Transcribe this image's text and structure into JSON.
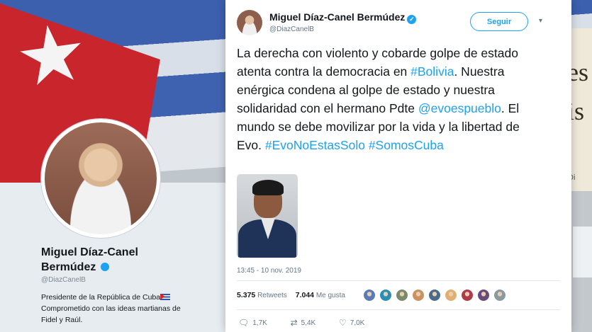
{
  "background_profile": {
    "name_line1": "Miguel Díaz-Canel",
    "name_line2": "Bermúdez",
    "handle": "@DiazCanelB",
    "bio_line1": "Presidente de la República de Cuba",
    "bio_line2": "Comprometido con las ideas martianas de",
    "bio_line3": "Fidel y Raúl.",
    "right_text_1": "es",
    "right_text_2": "is",
    "right_small": "Di"
  },
  "tweet": {
    "author_name": "Miguel Díaz-Canel Bermúdez",
    "author_handle": "@DiazCanelB",
    "follow_label": "Seguir",
    "text_segments": {
      "s1": "La derecha con violento y cobarde golpe de estado atenta contra la democracia en ",
      "l1": "#Bolivia",
      "s2": ". Nuestra enérgica condena  al golpe de estado y nuestra solidaridad con el hermano Pdte ",
      "l2": "@evoespueblo",
      "s3": ". El mundo se debe movilizar por la vida y la libertad de Evo. ",
      "l3": "#EvoNoEstasSolo",
      "s4": " ",
      "l4": "#SomosCuba"
    },
    "timestamp": "13:45 - 10 nov. 2019",
    "retweets_count": "5.375",
    "retweets_label": "Retweets",
    "likes_count": "7.044",
    "likes_label": "Me gusta",
    "reply_count": "1,7K",
    "retweet_action_count": "5,4K",
    "like_action_count": "7,0K"
  },
  "icons": {
    "caret": "chevron-down-icon",
    "reply": "reply-icon",
    "retweet": "retweet-icon",
    "like": "heart-icon",
    "verified": "verified-badge-icon"
  },
  "colors": {
    "accent": "#1da1f2",
    "text": "#14171a",
    "muted": "#657786"
  },
  "liker_colors": [
    "#5a7bb5",
    "#2a8fb5",
    "#7a8a6a",
    "#c9925f",
    "#4a6a8a",
    "#e0b070",
    "#b03a4a",
    "#6a4a7a",
    "#8a9aa0"
  ]
}
